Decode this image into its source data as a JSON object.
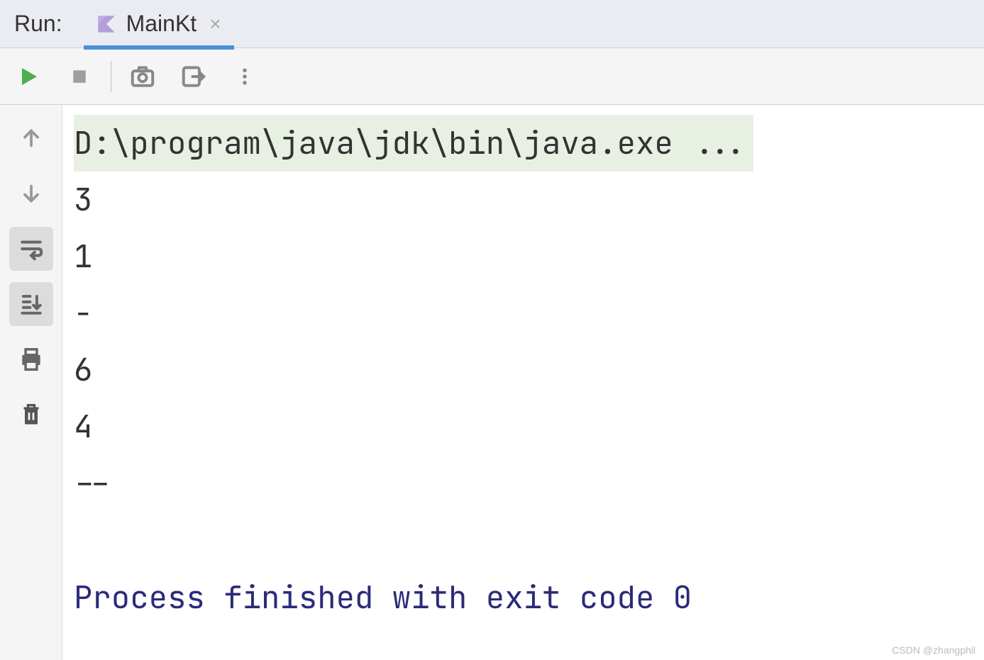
{
  "header": {
    "run_label": "Run:",
    "tab": {
      "label": "MainKt",
      "close_symbol": "×"
    }
  },
  "console": {
    "command": "D:\\program\\java\\jdk\\bin\\java.exe ...",
    "output_lines": [
      "3",
      "1",
      "-",
      "6",
      "4",
      "--",
      ""
    ],
    "exit_message": "Process finished with exit code 0"
  },
  "watermark": "CSDN @zhangphil"
}
